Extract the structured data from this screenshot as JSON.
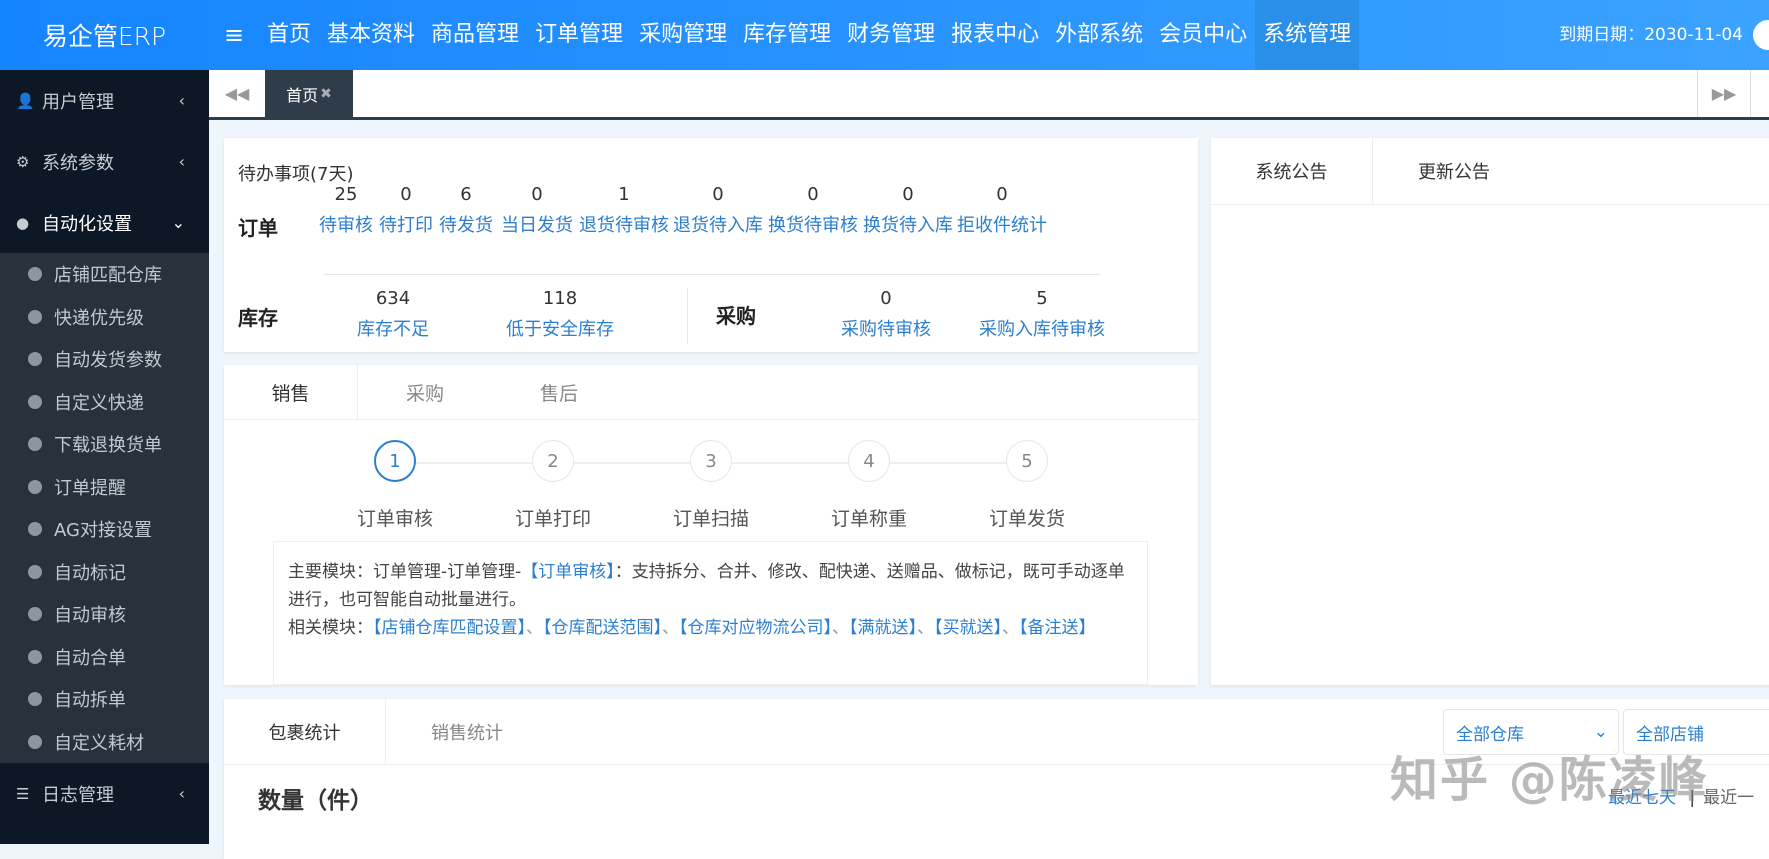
{
  "header": {
    "logo": "易企管ERP",
    "menu_icon": "≡",
    "nav": [
      "首页",
      "基本资料",
      "商品管理",
      "订单管理",
      "采购管理",
      "库存管理",
      "财务管理",
      "报表中心",
      "外部系统",
      "会员中心",
      "系统管理"
    ],
    "active_nav": "系统管理",
    "expire": "到期日期：2030-11-04"
  },
  "sidebar": {
    "top": [
      {
        "label": "用户管理",
        "icon": "user-icon"
      },
      {
        "label": "系统参数",
        "icon": "gears-icon"
      },
      {
        "label": "自动化设置",
        "icon": "android-icon"
      }
    ],
    "sub": [
      "店铺匹配仓库",
      "快递优先级",
      "自动发货参数",
      "自定义快递",
      "下载退换货单",
      "订单提醒",
      "AG对接设置",
      "自动标记",
      "自动审核",
      "自动合单",
      "自动拆单",
      "自定义耗材"
    ],
    "bottom": {
      "label": "日志管理",
      "icon": "list-icon"
    }
  },
  "tabs": {
    "home": "首页",
    "close": "✖"
  },
  "todo": {
    "title": "待办事项(7天)",
    "order_label": "订单",
    "orders": [
      {
        "n": "25",
        "l": "待审核"
      },
      {
        "n": "0",
        "l": "待打印"
      },
      {
        "n": "6",
        "l": "待发货"
      },
      {
        "n": "0",
        "l": "当日发货"
      },
      {
        "n": "1",
        "l": "退货待审核"
      },
      {
        "n": "0",
        "l": "退货待入库"
      },
      {
        "n": "0",
        "l": "换货待审核"
      },
      {
        "n": "0",
        "l": "换货待入库"
      },
      {
        "n": "0",
        "l": "拒收件统计"
      }
    ],
    "stock_label": "库存",
    "stock": [
      {
        "n": "634",
        "l": "库存不足"
      },
      {
        "n": "118",
        "l": "低于安全库存"
      }
    ],
    "purchase_label": "采购",
    "purchase": [
      {
        "n": "0",
        "l": "采购待审核"
      },
      {
        "n": "5",
        "l": "采购入库待审核"
      }
    ]
  },
  "notice": {
    "tabs": [
      "系统公告",
      "更新公告"
    ]
  },
  "process": {
    "tabs": [
      "销售",
      "采购",
      "售后"
    ],
    "steps": [
      {
        "n": "1",
        "t": "订单审核"
      },
      {
        "n": "2",
        "t": "订单打印"
      },
      {
        "n": "3",
        "t": "订单扫描"
      },
      {
        "n": "4",
        "t": "订单称重"
      },
      {
        "n": "5",
        "t": "订单发货"
      }
    ],
    "main_prefix": "主要模块：订单管理-订单管理-",
    "main_link": "【订单审核】",
    "main_text": "：支持拆分、合并、修改、配快递、送赠品、做标记，既可手动逐单进行，也可智能自动批量进行。",
    "related_prefix": "相关模块：",
    "related": [
      "【店铺仓库匹配设置】",
      "【仓库配送范围】",
      "【仓库对应物流公司】",
      "【满就送】",
      "【买就送】",
      "【备注送】"
    ],
    "sep": "、"
  },
  "stats": {
    "tabs": [
      "包裹统计",
      "销售统计"
    ],
    "warehouse": "全部仓库",
    "shop": "全部店铺",
    "qty_title": "数量（件）",
    "range_active": "最近七天",
    "range_sep": "|",
    "range_other": "最近一"
  },
  "watermark": "知乎 @陈凌峰",
  "colors": {
    "header": "#1584ff",
    "sidebar": "#0c1826",
    "link": "#2b7fd0"
  }
}
